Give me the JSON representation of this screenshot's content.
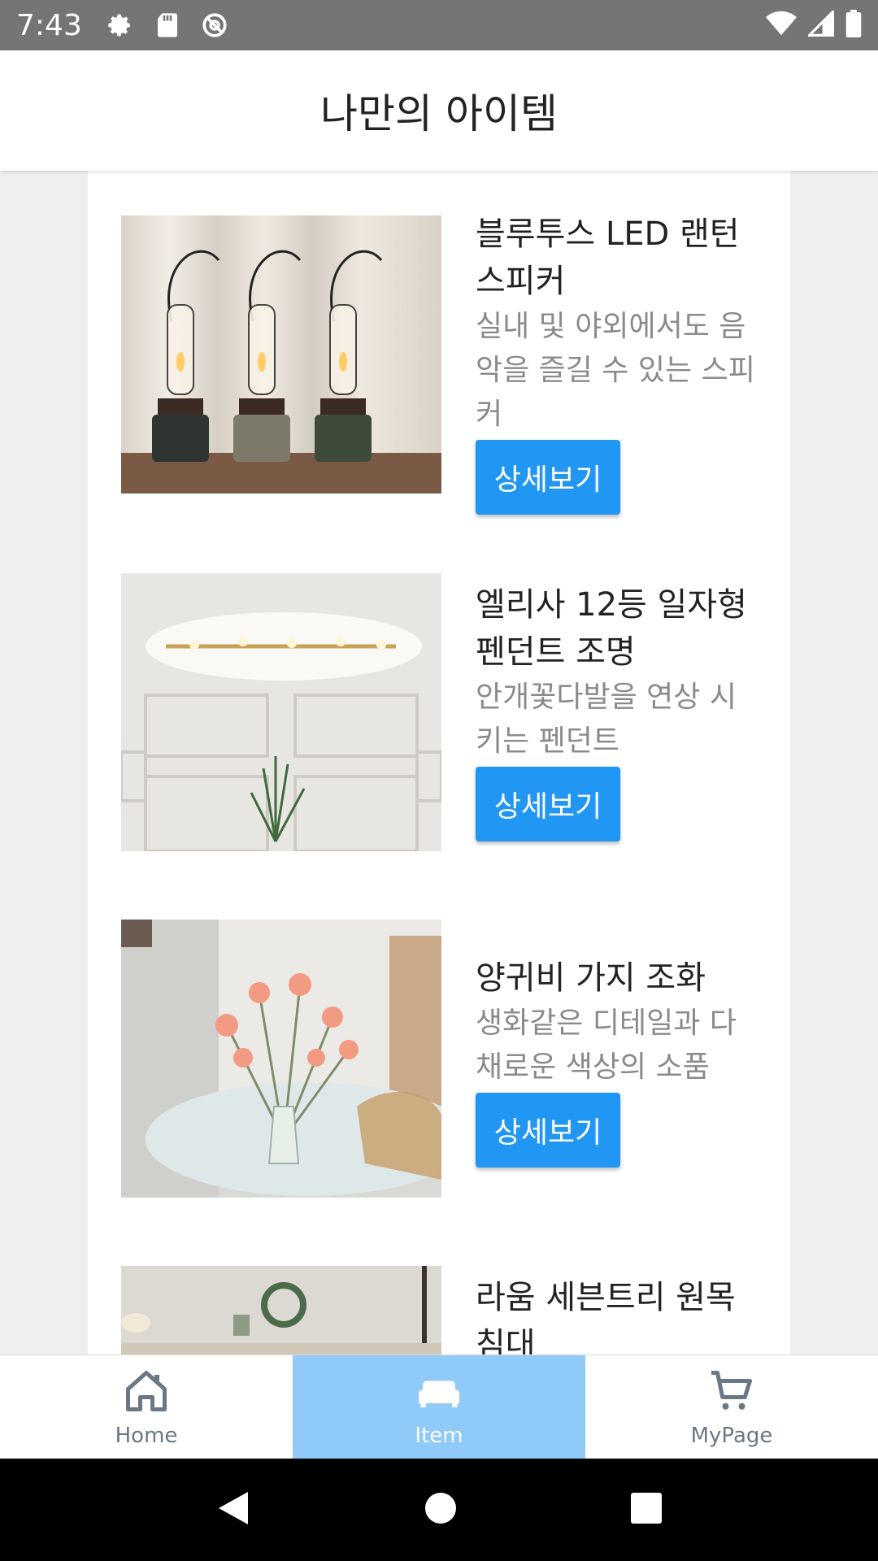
{
  "status_bar": {
    "time": "7:43",
    "left_icons": [
      "gear-icon",
      "sd-card-icon",
      "sync-off-icon"
    ],
    "right_icons": [
      "wifi-icon",
      "signal-icon",
      "battery-icon"
    ]
  },
  "header": {
    "title": "나만의 아이템"
  },
  "items": [
    {
      "name": "블루투스 LED 랜턴 스피커",
      "description": "실내 및 야외에서도 음악을 즐길 수 있는 스피커",
      "button_label": "상세보기",
      "image": "lantern-speakers-photo"
    },
    {
      "name": "엘리사 12등 일자형 펜던트 조명",
      "description": "안개꽃다발을 연상 시키는 펜던트",
      "button_label": "상세보기",
      "image": "pendant-light-photo"
    },
    {
      "name": "양귀비 가지 조화",
      "description": "생화같은 디테일과 다채로운 색상의 소품",
      "button_label": "상세보기",
      "image": "poppy-flowers-photo"
    },
    {
      "name": "라움 세븐트리 원목 침대",
      "image": "wooden-bed-photo"
    }
  ],
  "bottom_nav": {
    "items": [
      {
        "label": "Home",
        "icon": "home-icon",
        "active": false
      },
      {
        "label": "Item",
        "icon": "bed-icon",
        "active": true
      },
      {
        "label": "MyPage",
        "icon": "cart-icon",
        "active": false
      }
    ]
  },
  "colors": {
    "primary": "#2196F3",
    "nav_active_bg": "#90CAF9",
    "status_bar": "#757575"
  }
}
